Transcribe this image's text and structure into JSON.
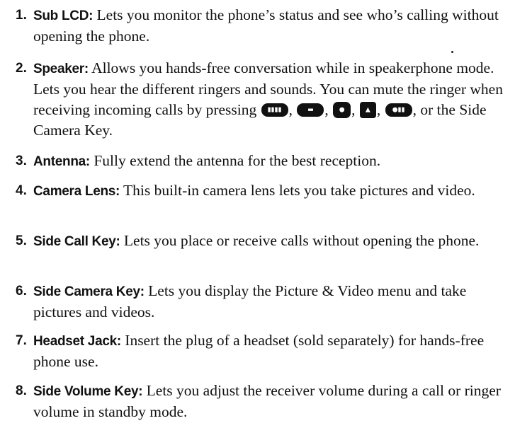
{
  "items": [
    {
      "num": "1.",
      "term": "Sub LCD:",
      "text": " Lets you monitor the phone’s status and see who’s calling without opening the phone."
    },
    {
      "num": "2.",
      "term": "Speaker:",
      "text_before": " Allows you hands-free conversation while in speakerphone mode. Lets you hear the different ringers and sounds. You can mute the ringer when receiving incoming calls by pressing ",
      "sep": ",",
      "text_after": ", or the Side Camera Key."
    },
    {
      "num": "3.",
      "term": "Antenna:",
      "text": " Fully extend the antenna for the best reception."
    },
    {
      "num": "4.",
      "term": "Camera Lens:",
      "text": " This built-in camera lens lets you take pictures and video."
    },
    {
      "num": "5.",
      "term": "Side Call Key:",
      "text": " Lets you place or receive calls without opening the phone."
    },
    {
      "num": "6.",
      "term": "Side Camera Key:",
      "text": " Lets you display the Picture & Video menu and take pictures and videos."
    },
    {
      "num": "7.",
      "term": "Headset Jack:",
      "text": " Insert the plug of a headset (sold separately) for hands-free phone use."
    },
    {
      "num": "8.",
      "term": "Side Volume Key:",
      "text": " Lets you adjust the receiver volume during a call or ringer volume in standby mode."
    }
  ],
  "key_icons": [
    "volume-key-icon",
    "end-key-icon",
    "camera-key-icon",
    "speaker-key-icon",
    "side-key-icon"
  ]
}
